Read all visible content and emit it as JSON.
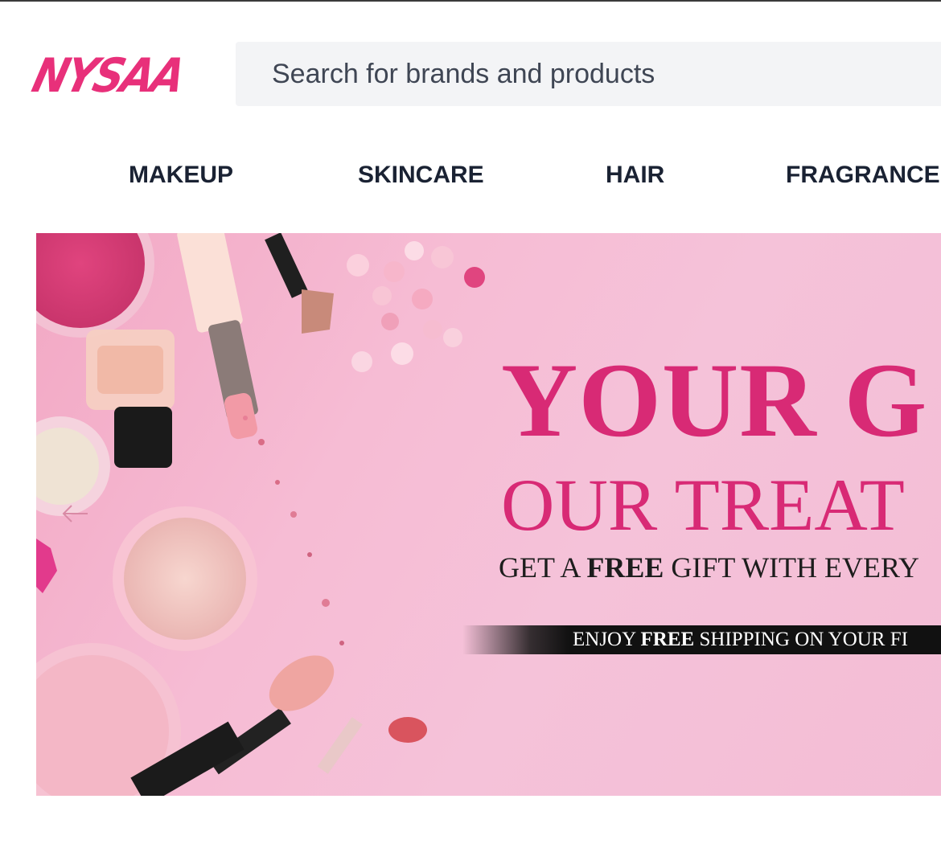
{
  "header": {
    "logo_text": "NYSAA",
    "logo_color": "#e8307a",
    "search": {
      "placeholder": "Search for brands and products",
      "value": ""
    }
  },
  "nav": {
    "items": [
      {
        "label": "MAKEUP"
      },
      {
        "label": "SKINCARE"
      },
      {
        "label": "HAIR"
      },
      {
        "label": "FRAGRANCE"
      }
    ]
  },
  "banner": {
    "headline_1": "YOUR G",
    "headline_2": "OUR TREAT",
    "sub_pre": "GET A ",
    "sub_bold": "FREE",
    "sub_post": " GIFT WITH EVERY",
    "ship_pre": "ENJOY ",
    "ship_bold": "FREE",
    "ship_post": " SHIPPING ON YOUR FI",
    "accent_color": "#d82a75",
    "prev_icon": "arrow-left-icon"
  }
}
